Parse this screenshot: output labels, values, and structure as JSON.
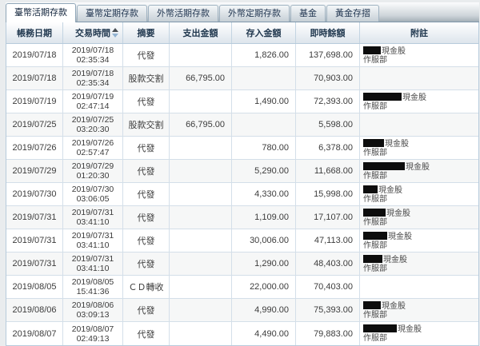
{
  "colors": {
    "accent_border": "#b7cbdc",
    "tab_strip_dark": "#a4afb7",
    "header_text": "#21384f",
    "row_alt": "#f6f7f7",
    "redaction": "#0d0d0d",
    "sort_down_arrow": "#92b3d2"
  },
  "tabs": [
    {
      "label": "臺幣活期存款",
      "active": true
    },
    {
      "label": "臺幣定期存款",
      "active": false
    },
    {
      "label": "外幣活期存款",
      "active": false
    },
    {
      "label": "外幣定期存款",
      "active": false
    },
    {
      "label": "基金",
      "active": false
    },
    {
      "label": "黃金存摺",
      "active": false
    }
  ],
  "table": {
    "headers": [
      {
        "label": "帳務日期",
        "sortable": false
      },
      {
        "label": "交易時間",
        "sortable": true
      },
      {
        "label": "摘要",
        "sortable": false
      },
      {
        "label": "支出金額",
        "sortable": false
      },
      {
        "label": "存入金額",
        "sortable": false
      },
      {
        "label": "即時餘額",
        "sortable": false
      },
      {
        "label": "附註",
        "sortable": false
      }
    ],
    "rows": [
      {
        "date": "2019/07/18",
        "txn_date": "2019/07/18",
        "txn_time": "02:35:34",
        "summary": "代發",
        "out": "",
        "in": "1,826.00",
        "balance": "137,698.00",
        "note_redact_width": 22,
        "note_line1": "現金股",
        "note_line2": "作服部"
      },
      {
        "date": "2019/07/18",
        "txn_date": "2019/07/18",
        "txn_time": "02:35:34",
        "summary": "股款交割",
        "out": "66,795.00",
        "in": "",
        "balance": "70,903.00",
        "note_redact_width": 0,
        "note_line1": "",
        "note_line2": ""
      },
      {
        "date": "2019/07/19",
        "txn_date": "2019/07/19",
        "txn_time": "02:47:14",
        "summary": "代發",
        "out": "",
        "in": "1,490.00",
        "balance": "72,393.00",
        "note_redact_width": 48,
        "note_line1": "現金股",
        "note_line2": "作服部"
      },
      {
        "date": "2019/07/25",
        "txn_date": "2019/07/25",
        "txn_time": "03:20:30",
        "summary": "股款交割",
        "out": "66,795.00",
        "in": "",
        "balance": "5,598.00",
        "note_redact_width": 0,
        "note_line1": "",
        "note_line2": ""
      },
      {
        "date": "2019/07/26",
        "txn_date": "2019/07/26",
        "txn_time": "02:57:47",
        "summary": "代發",
        "out": "",
        "in": "780.00",
        "balance": "6,378.00",
        "note_redact_width": 26,
        "note_line1": "現金股",
        "note_line2": "作服部"
      },
      {
        "date": "2019/07/29",
        "txn_date": "2019/07/29",
        "txn_time": "01:20:30",
        "summary": "代發",
        "out": "",
        "in": "5,290.00",
        "balance": "11,668.00",
        "note_redact_width": 52,
        "note_line1": "現金股",
        "note_line2": "作服部"
      },
      {
        "date": "2019/07/30",
        "txn_date": "2019/07/30",
        "txn_time": "03:06:05",
        "summary": "代發",
        "out": "",
        "in": "4,330.00",
        "balance": "15,998.00",
        "note_redact_width": 18,
        "note_line1": "現金股",
        "note_line2": "作服部"
      },
      {
        "date": "2019/07/31",
        "txn_date": "2019/07/31",
        "txn_time": "03:41:10",
        "summary": "代發",
        "out": "",
        "in": "1,109.00",
        "balance": "17,107.00",
        "note_redact_width": 28,
        "note_line1": "現金股",
        "note_line2": "作服部"
      },
      {
        "date": "2019/07/31",
        "txn_date": "2019/07/31",
        "txn_time": "03:41:10",
        "summary": "代發",
        "out": "",
        "in": "30,006.00",
        "balance": "47,113.00",
        "note_redact_width": 30,
        "note_line1": "現金股",
        "note_line2": "作服部"
      },
      {
        "date": "2019/07/31",
        "txn_date": "2019/07/31",
        "txn_time": "03:41:10",
        "summary": "代發",
        "out": "",
        "in": "1,290.00",
        "balance": "48,403.00",
        "note_redact_width": 24,
        "note_line1": "現金股",
        "note_line2": "作服部"
      },
      {
        "date": "2019/08/05",
        "txn_date": "2019/08/05",
        "txn_time": "15:41:36",
        "summary": "ＣＤ轉收",
        "out": "",
        "in": "22,000.00",
        "balance": "70,403.00",
        "note_redact_width": 0,
        "note_line1": "",
        "note_line2": ""
      },
      {
        "date": "2019/08/06",
        "txn_date": "2019/08/06",
        "txn_time": "03:09:13",
        "summary": "代發",
        "out": "",
        "in": "4,990.00",
        "balance": "75,393.00",
        "note_redact_width": 22,
        "note_line1": "現金股",
        "note_line2": "作服部"
      },
      {
        "date": "2019/08/07",
        "txn_date": "2019/08/07",
        "txn_time": "02:49:13",
        "summary": "代發",
        "out": "",
        "in": "4,490.00",
        "balance": "79,883.00",
        "note_redact_width": 42,
        "note_line1": "現金股",
        "note_line2": "作服部"
      }
    ]
  }
}
